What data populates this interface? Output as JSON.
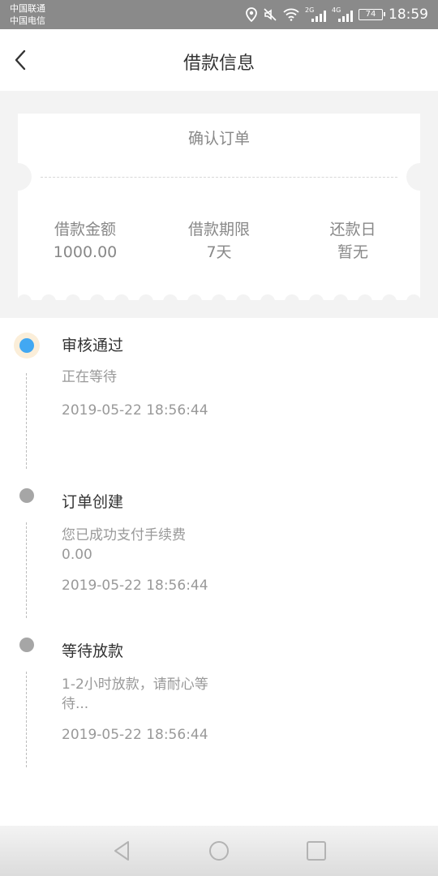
{
  "status_bar": {
    "carrier_1": "中国联通",
    "carrier_2": "中国电信",
    "sim1_net": "2G",
    "sim2_net": "4G",
    "battery": "74",
    "time": "18:59"
  },
  "header": {
    "title": "借款信息",
    "back_icon": "chevron-left-icon"
  },
  "ticket": {
    "heading": "确认订单",
    "amount_label": "借款金额",
    "amount_value": "1000.00",
    "term_label": "借款期限",
    "term_value": "7天",
    "due_label": "还款日",
    "due_value": "暂无"
  },
  "timeline": [
    {
      "title": "审核通过",
      "desc": "正在等待",
      "time": "2019-05-22 18:56:44",
      "active": true
    },
    {
      "title": "订单创建",
      "desc": "您已成功支付手续费0.00",
      "time": "2019-05-22 18:56:44",
      "active": false
    },
    {
      "title": "等待放款",
      "desc": "1-2小时放款，请耐心等待...",
      "time": "2019-05-22 18:56:44",
      "active": false
    }
  ],
  "colors": {
    "accent": "#42a8f2",
    "halo": "#fbeed9",
    "inactive_dot": "#a6a6a6",
    "page_bg": "#f3f3f3"
  },
  "nav_icons": [
    "back-triangle-icon",
    "home-circle-icon",
    "recents-square-icon"
  ]
}
